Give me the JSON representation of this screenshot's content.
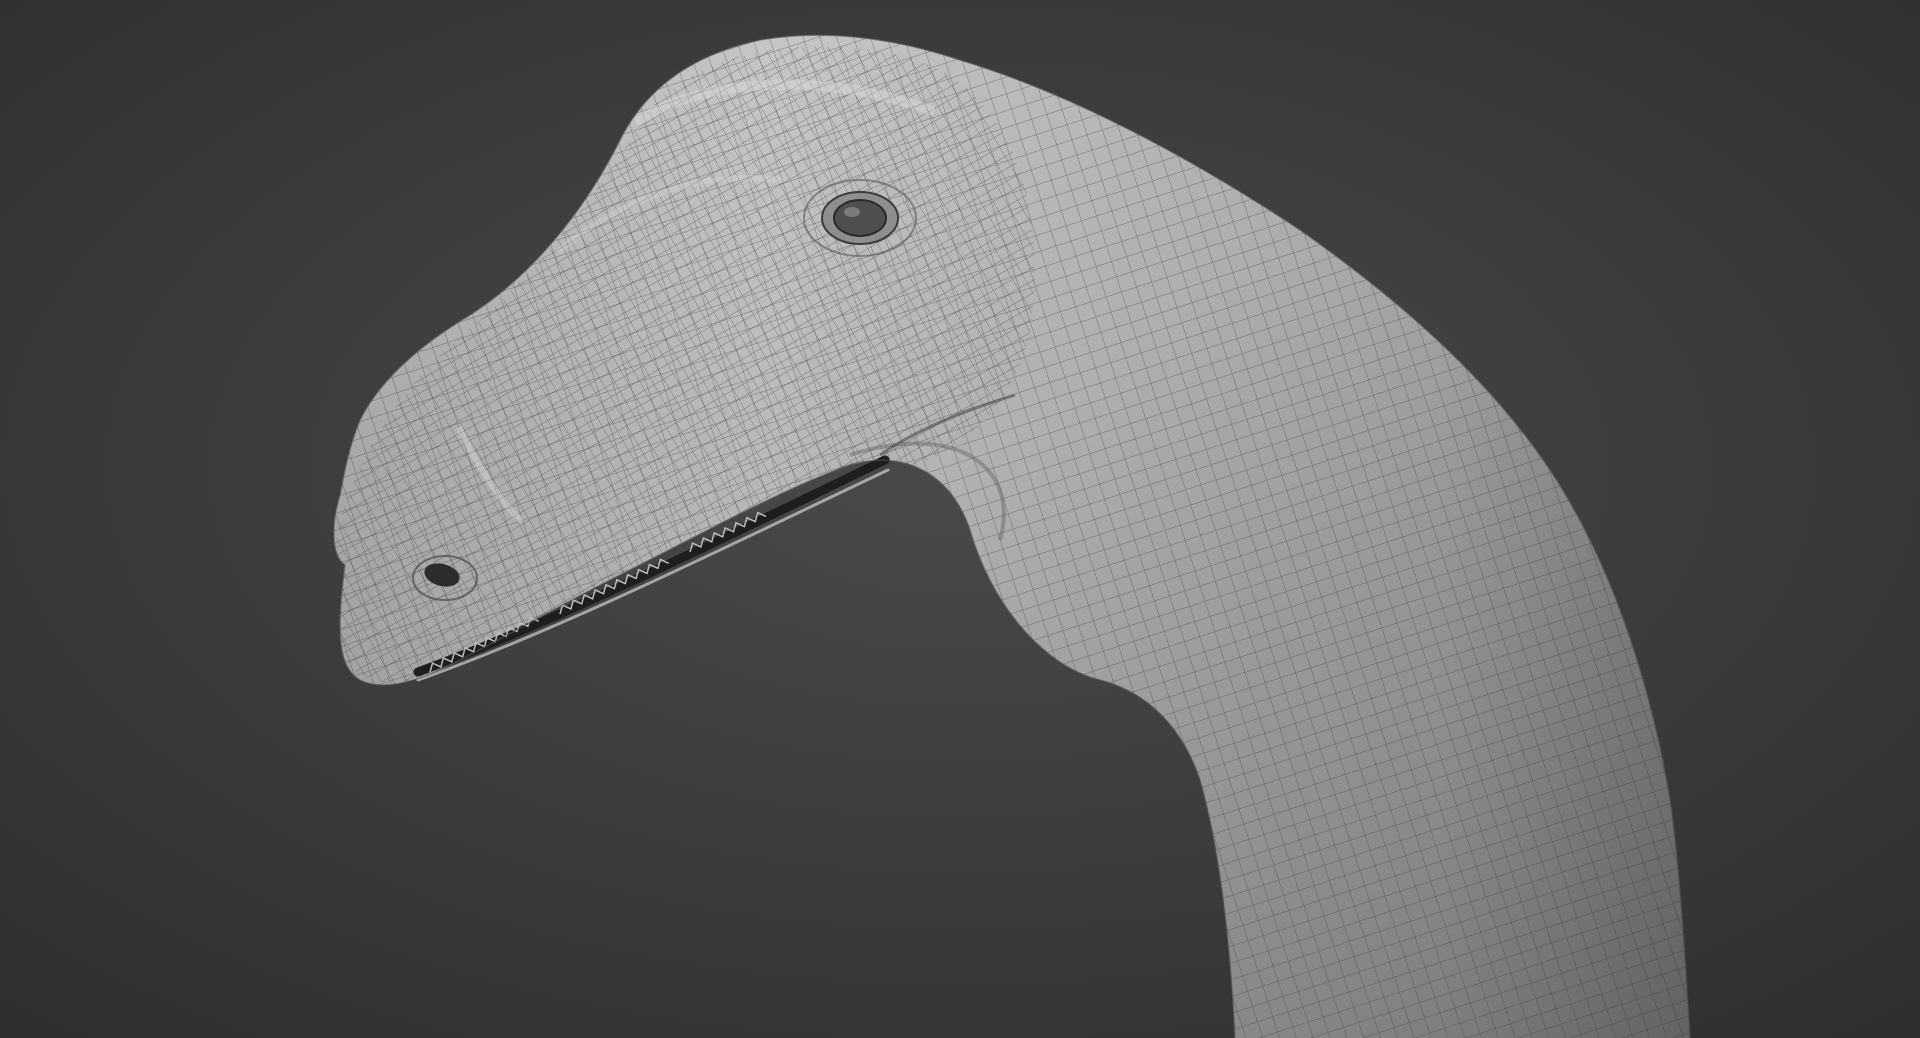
{
  "scene": {
    "subject_icon": "dinosaur-head-wireframe-icon",
    "colors": {
      "background_center": "#4a4a4a",
      "background_edge": "#2e2e2e",
      "skin_light": "#c9c9c9",
      "skin_mid": "#9e9e9e",
      "skin_dark": "#6b6b6b",
      "wire": "#3c3c3c",
      "mouth": "#1e1e1e"
    }
  }
}
